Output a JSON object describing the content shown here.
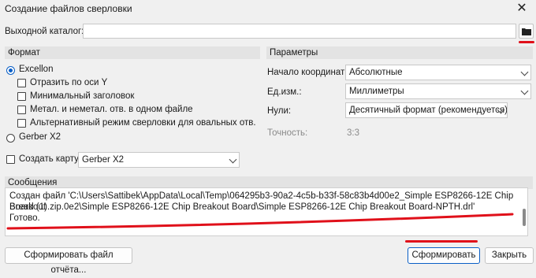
{
  "window": {
    "title": "Создание файлов сверловки",
    "close_glyph": "✕"
  },
  "output_dir": {
    "label": "Выходной каталог:",
    "value": "",
    "folder_icon": "folder-icon"
  },
  "format": {
    "title": "Формат",
    "excellon_label": "Excellon",
    "options": [
      "Отразить по оси Y",
      "Минимальный заголовок",
      "Метал. и неметал. отв. в одном файле",
      "Альтернативный режим сверловки для овальных отв."
    ],
    "gerber_label": "Gerber X2",
    "create_map_label": "Создать карту:",
    "map_format": "Gerber X2"
  },
  "params": {
    "title": "Параметры",
    "origin_label": "Начало координат:",
    "origin_value": "Абсолютные",
    "units_label": "Ед.изм.:",
    "units_value": "Миллиметры",
    "zeros_label": "Нули:",
    "zeros_value": "Десятичный формат (рекомендуется)",
    "precision_label": "Точность:",
    "precision_value": "3:3"
  },
  "messages": {
    "title": "Сообщения",
    "line1": "Создан файл 'C:\\Users\\Sattibek\\AppData\\Local\\Temp\\064295b3-90a2-4c5b-b33f-58c83b4d00e2_Simple ESP8266-12E Chip Breakout",
    "line2": "Board (1).zip.0e2\\Simple ESP8266-12E Chip Breakout Board\\Simple ESP8266-12E Chip Breakout Board-NPTH.drl'",
    "line3": "Готово."
  },
  "buttons": {
    "report": "Сформировать файл отчёта...",
    "generate": "Сформировать",
    "close": "Закрыть"
  },
  "colors": {
    "accent": "#0a5fc6",
    "annotation_red": "#e0101a"
  }
}
